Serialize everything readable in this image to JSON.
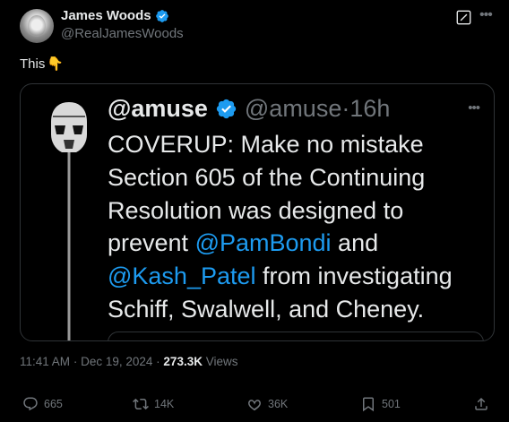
{
  "author": {
    "display_name": "James Woods",
    "handle": "@RealJamesWoods",
    "verified_color": "#1d9bf0"
  },
  "tweet": {
    "text": "This",
    "emoji": "👇"
  },
  "quoted_image": {
    "name": "@amuse",
    "meta": "@amuse·16h",
    "body_lines": [
      {
        "parts": [
          {
            "text": "COVERUP: Make no mistake"
          }
        ]
      },
      {
        "parts": [
          {
            "text": "Section 605 of the Continuing"
          }
        ]
      },
      {
        "parts": [
          {
            "text": "Resolution was designed to"
          }
        ]
      },
      {
        "parts": [
          {
            "text": "prevent "
          },
          {
            "text": "@PamBondi",
            "mention": true
          },
          {
            "text": " and"
          }
        ]
      },
      {
        "parts": [
          {
            "text": "@Kash_Patel",
            "mention": true
          },
          {
            "text": " from investigating"
          }
        ]
      },
      {
        "parts": [
          {
            "text": "Schiff, Swalwell, and Cheney."
          }
        ]
      }
    ],
    "mention_color": "#1d9bf0"
  },
  "meta": {
    "time": "11:41 AM",
    "date": "Dec 19, 2024",
    "separator": "·",
    "views": "273.3K",
    "views_label": "Views"
  },
  "actions": {
    "replies": "665",
    "reposts": "14K",
    "likes": "36K",
    "bookmarks": "501"
  },
  "icons": [
    "verified-badge-icon",
    "grok-icon",
    "more-icon",
    "point-down-icon",
    "reply-icon",
    "repost-icon",
    "like-icon",
    "bookmark-icon",
    "share-icon"
  ]
}
